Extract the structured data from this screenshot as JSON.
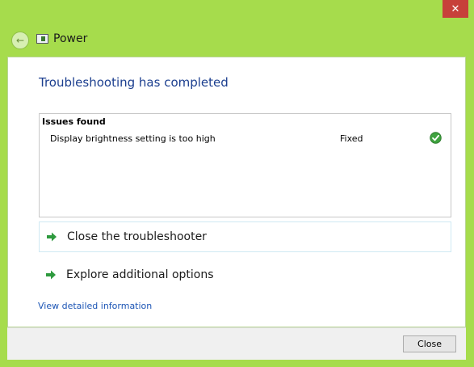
{
  "window": {
    "title": "Power",
    "close_glyph": "✕"
  },
  "main": {
    "heading": "Troubleshooting has completed",
    "issues": {
      "header": "Issues found",
      "items": [
        {
          "name": "Display brightness setting is too high",
          "status": "Fixed",
          "icon": "check-icon"
        }
      ]
    },
    "options": [
      {
        "label": "Close the troubleshooter",
        "icon": "green-arrow-icon"
      },
      {
        "label": "Explore additional options",
        "icon": "green-arrow-icon"
      }
    ],
    "details_link": "View detailed information"
  },
  "footer": {
    "close_label": "Close"
  },
  "colors": {
    "frame": "#a6dc4c",
    "heading": "#1c3f8f",
    "link": "#1c55b5",
    "close_x": "#c7403a"
  }
}
